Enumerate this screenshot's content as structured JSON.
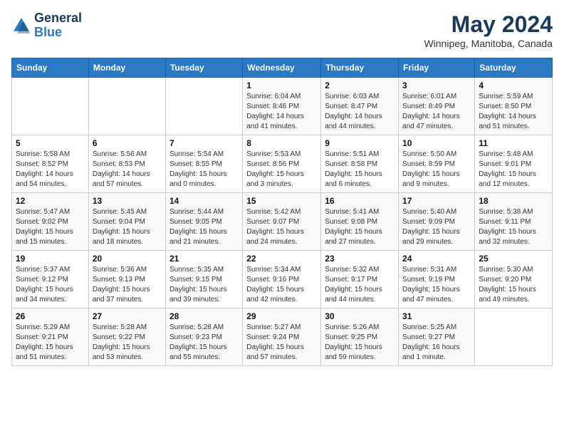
{
  "header": {
    "logo_line1": "General",
    "logo_line2": "Blue",
    "month": "May 2024",
    "location": "Winnipeg, Manitoba, Canada"
  },
  "days_of_week": [
    "Sunday",
    "Monday",
    "Tuesday",
    "Wednesday",
    "Thursday",
    "Friday",
    "Saturday"
  ],
  "weeks": [
    [
      {
        "num": "",
        "info": ""
      },
      {
        "num": "",
        "info": ""
      },
      {
        "num": "",
        "info": ""
      },
      {
        "num": "1",
        "info": "Sunrise: 6:04 AM\nSunset: 8:46 PM\nDaylight: 14 hours\nand 41 minutes."
      },
      {
        "num": "2",
        "info": "Sunrise: 6:03 AM\nSunset: 8:47 PM\nDaylight: 14 hours\nand 44 minutes."
      },
      {
        "num": "3",
        "info": "Sunrise: 6:01 AM\nSunset: 8:49 PM\nDaylight: 14 hours\nand 47 minutes."
      },
      {
        "num": "4",
        "info": "Sunrise: 5:59 AM\nSunset: 8:50 PM\nDaylight: 14 hours\nand 51 minutes."
      }
    ],
    [
      {
        "num": "5",
        "info": "Sunrise: 5:58 AM\nSunset: 8:52 PM\nDaylight: 14 hours\nand 54 minutes."
      },
      {
        "num": "6",
        "info": "Sunrise: 5:56 AM\nSunset: 8:53 PM\nDaylight: 14 hours\nand 57 minutes."
      },
      {
        "num": "7",
        "info": "Sunrise: 5:54 AM\nSunset: 8:55 PM\nDaylight: 15 hours\nand 0 minutes."
      },
      {
        "num": "8",
        "info": "Sunrise: 5:53 AM\nSunset: 8:56 PM\nDaylight: 15 hours\nand 3 minutes."
      },
      {
        "num": "9",
        "info": "Sunrise: 5:51 AM\nSunset: 8:58 PM\nDaylight: 15 hours\nand 6 minutes."
      },
      {
        "num": "10",
        "info": "Sunrise: 5:50 AM\nSunset: 8:59 PM\nDaylight: 15 hours\nand 9 minutes."
      },
      {
        "num": "11",
        "info": "Sunrise: 5:48 AM\nSunset: 9:01 PM\nDaylight: 15 hours\nand 12 minutes."
      }
    ],
    [
      {
        "num": "12",
        "info": "Sunrise: 5:47 AM\nSunset: 9:02 PM\nDaylight: 15 hours\nand 15 minutes."
      },
      {
        "num": "13",
        "info": "Sunrise: 5:45 AM\nSunset: 9:04 PM\nDaylight: 15 hours\nand 18 minutes."
      },
      {
        "num": "14",
        "info": "Sunrise: 5:44 AM\nSunset: 9:05 PM\nDaylight: 15 hours\nand 21 minutes."
      },
      {
        "num": "15",
        "info": "Sunrise: 5:42 AM\nSunset: 9:07 PM\nDaylight: 15 hours\nand 24 minutes."
      },
      {
        "num": "16",
        "info": "Sunrise: 5:41 AM\nSunset: 9:08 PM\nDaylight: 15 hours\nand 27 minutes."
      },
      {
        "num": "17",
        "info": "Sunrise: 5:40 AM\nSunset: 9:09 PM\nDaylight: 15 hours\nand 29 minutes."
      },
      {
        "num": "18",
        "info": "Sunrise: 5:38 AM\nSunset: 9:11 PM\nDaylight: 15 hours\nand 32 minutes."
      }
    ],
    [
      {
        "num": "19",
        "info": "Sunrise: 5:37 AM\nSunset: 9:12 PM\nDaylight: 15 hours\nand 34 minutes."
      },
      {
        "num": "20",
        "info": "Sunrise: 5:36 AM\nSunset: 9:13 PM\nDaylight: 15 hours\nand 37 minutes."
      },
      {
        "num": "21",
        "info": "Sunrise: 5:35 AM\nSunset: 9:15 PM\nDaylight: 15 hours\nand 39 minutes."
      },
      {
        "num": "22",
        "info": "Sunrise: 5:34 AM\nSunset: 9:16 PM\nDaylight: 15 hours\nand 42 minutes."
      },
      {
        "num": "23",
        "info": "Sunrise: 5:32 AM\nSunset: 9:17 PM\nDaylight: 15 hours\nand 44 minutes."
      },
      {
        "num": "24",
        "info": "Sunrise: 5:31 AM\nSunset: 9:19 PM\nDaylight: 15 hours\nand 47 minutes."
      },
      {
        "num": "25",
        "info": "Sunrise: 5:30 AM\nSunset: 9:20 PM\nDaylight: 15 hours\nand 49 minutes."
      }
    ],
    [
      {
        "num": "26",
        "info": "Sunrise: 5:29 AM\nSunset: 9:21 PM\nDaylight: 15 hours\nand 51 minutes."
      },
      {
        "num": "27",
        "info": "Sunrise: 5:28 AM\nSunset: 9:22 PM\nDaylight: 15 hours\nand 53 minutes."
      },
      {
        "num": "28",
        "info": "Sunrise: 5:28 AM\nSunset: 9:23 PM\nDaylight: 15 hours\nand 55 minutes."
      },
      {
        "num": "29",
        "info": "Sunrise: 5:27 AM\nSunset: 9:24 PM\nDaylight: 15 hours\nand 57 minutes."
      },
      {
        "num": "30",
        "info": "Sunrise: 5:26 AM\nSunset: 9:25 PM\nDaylight: 15 hours\nand 59 minutes."
      },
      {
        "num": "31",
        "info": "Sunrise: 5:25 AM\nSunset: 9:27 PM\nDaylight: 16 hours\nand 1 minute."
      },
      {
        "num": "",
        "info": ""
      }
    ]
  ]
}
